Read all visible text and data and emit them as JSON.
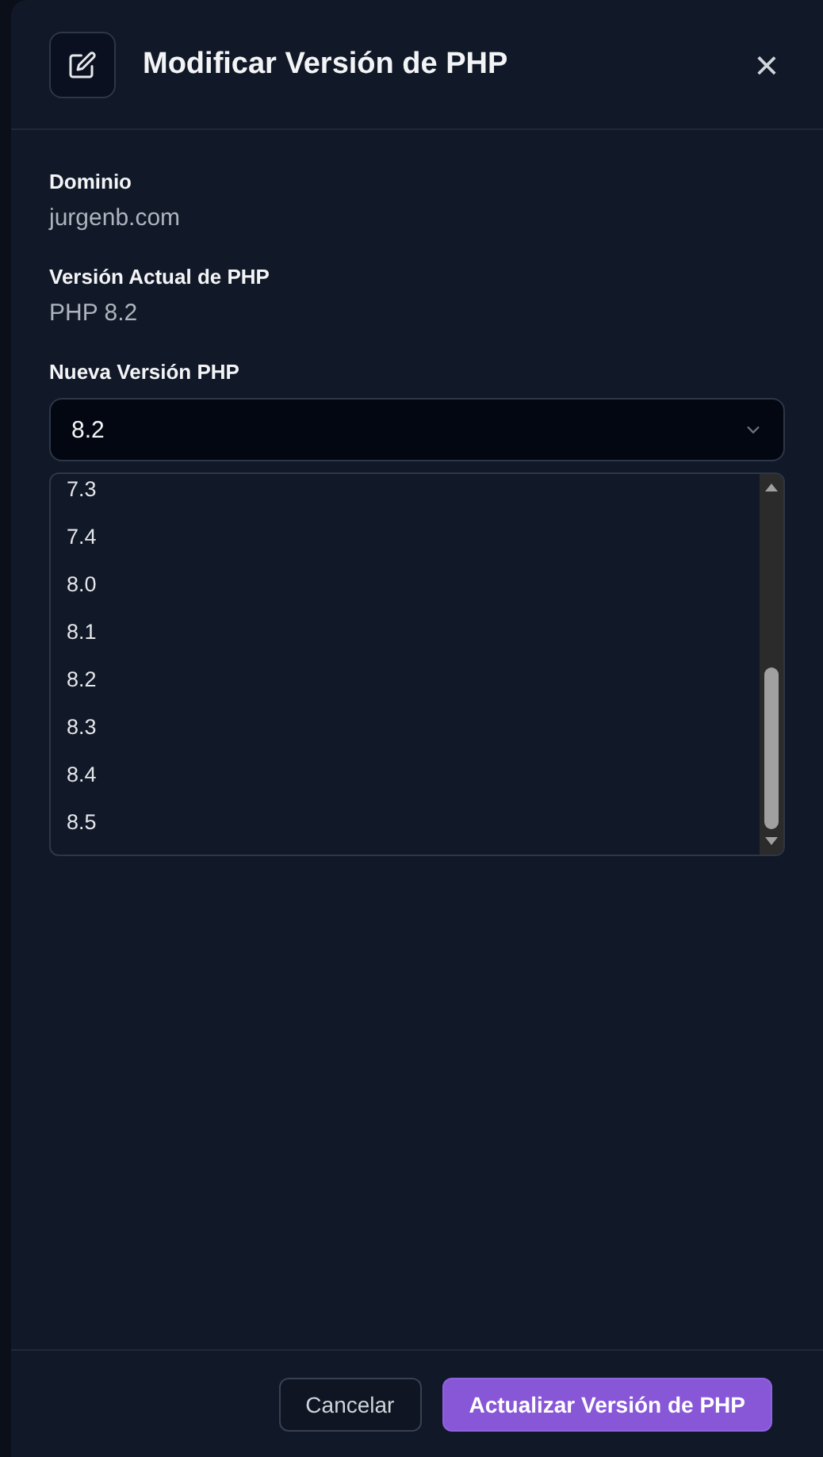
{
  "dialog": {
    "title": "Modificar Versión de PHP",
    "close": "×"
  },
  "fields": [
    {
      "label": "Dominio",
      "value": "jurgenb.com"
    },
    {
      "label": "Versión Actual de PHP",
      "value": "PHP 8.2"
    }
  ],
  "select": {
    "label": "Nueva Versión PHP",
    "value": "8.2",
    "options": [
      "7.3",
      "7.4",
      "8.0",
      "8.1",
      "8.2",
      "8.3",
      "8.4",
      "8.5"
    ]
  },
  "buttons": [
    {
      "label": "Cancelar",
      "kind": "secondary"
    },
    {
      "label": "Actualizar Versión de PHP",
      "kind": "primary"
    }
  ]
}
